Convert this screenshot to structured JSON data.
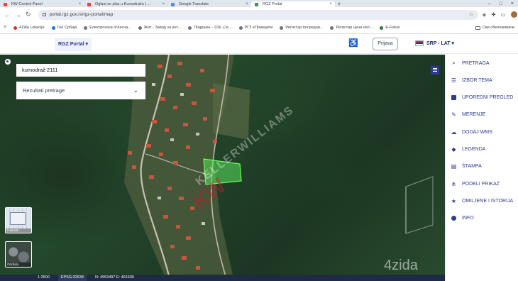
{
  "browser": {
    "tabs": [
      {
        "title": "KW Control Panel",
        "active": false
      },
      {
        "title": "Oglasi se plac u Kumodražu | ...",
        "active": false
      },
      {
        "title": "Google Translate",
        "active": false
      },
      {
        "title": "RGZ Portal",
        "active": true
      }
    ],
    "new_tab": "+",
    "url": "portal.rgz.gov.rs/rgz-portal/map",
    "bookmarks": [
      "4Zida Lokacije",
      "Гео Србија",
      "Електронска огласна...",
      "Жит - Завод за инт...",
      "Подршка – ОШ „Св...",
      "РГЗ еПринципи",
      "Регистар посредни...",
      "Регистар цена неп...",
      "E-Fiskal"
    ],
    "bookmarks_folder": "Сви обележивачи"
  },
  "header": {
    "portal_label": "RGZ Portal ▾",
    "login_label": "Prijava",
    "language_label": "SRP - LAT ▾"
  },
  "map": {
    "search_value": "kumodraž 2111",
    "results_placeholder": "Rezultati pretrage",
    "basemaps": [
      "Katastar",
      "Ortofoto"
    ],
    "scale_text": "1:2500",
    "epsg_text": "EPSG:32634",
    "coords_text": "N: 4953497  E: 461600",
    "watermark_brand": "4zida",
    "watermark_diag": "KELLERWILLIAMS",
    "watermark_kw": "KW"
  },
  "menu": [
    {
      "label": "PRETRAGA",
      "icon": "search-icon"
    },
    {
      "label": "IZBOR TEMA",
      "icon": "layers-icon"
    },
    {
      "label": "UPOREDNI PREGLED",
      "icon": "compare-icon"
    },
    {
      "label": "MERENJE",
      "icon": "ruler-icon"
    },
    {
      "label": "DODAJ WMS",
      "icon": "cloud-upload-icon"
    },
    {
      "label": "LEGENDA",
      "icon": "tag-icon"
    },
    {
      "label": "ŠTAMPA",
      "icon": "print-icon"
    },
    {
      "label": "PODELI PRIKAZ",
      "icon": "share-icon"
    },
    {
      "label": "OMILJENE I ISTORIJA",
      "icon": "star-icon"
    },
    {
      "label": "INFO",
      "icon": "info-icon"
    }
  ],
  "colors": {
    "brand": "#2f3b8f",
    "parcel": "#59e35a",
    "forest": "#1e3b25"
  }
}
